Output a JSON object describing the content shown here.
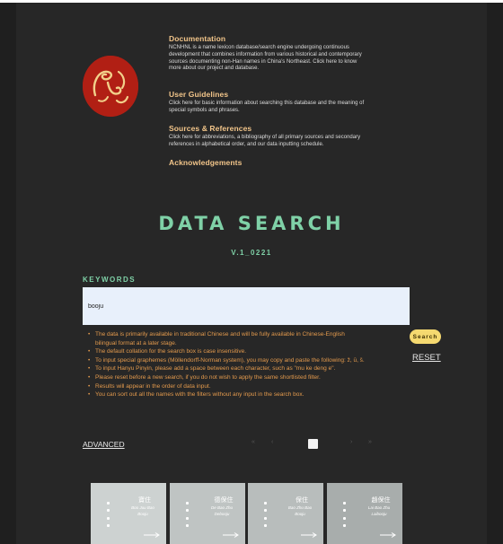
{
  "intro": {
    "sections": [
      {
        "heading": "Documentation",
        "text": "NCNHNL is a name lexicon database/search engine undergoing continuous development that combines information from various historical and contemporary sources documenting non-Han names in China’s Northeast. Click here to know more about our project and database."
      },
      {
        "heading": "User Guidelines",
        "text": "Click here for basic information about searching this database and the meaning of special symbols and phrases."
      },
      {
        "heading": "Sources & References",
        "text": "Click here for abbreviations, a bibliography of all primary sources and secondary references in alphabetical order, and our data inputting schedule."
      },
      {
        "heading": "Acknowledgements",
        "text": ""
      }
    ]
  },
  "search": {
    "title": "DATA SEARCH",
    "version": "V.1_0221",
    "keywords_label": "KEYWORDS",
    "query": "booju",
    "search_label": "Search",
    "reset_label": "RESET",
    "advanced_label": "ADVANCED"
  },
  "notes": [
    "The data is primarily available in traditional Chinese and will be fully available in Chinese-English bilingual format at a later stage.",
    "The default collation for the search box is case insensitive.",
    "To input special graphemes (Möllendorff-Norman system), you may copy and paste the following: ž, ū, š.",
    "To input Hanyu Pinyin, please add a space between each character, such as \"mu ke deng e\".",
    "Please reset before a new search, if you do not wish to apply the same shortlisted filter.",
    "Results will appear in the order of data input.",
    "You can sort out all the names with the filters without any input in the search box."
  ],
  "pagination": {
    "first": "«",
    "prev": "‹",
    "next": "›",
    "last": "»"
  },
  "results": [
    {
      "name": "寶住",
      "romanized": "Boo Juu Bao",
      "transcription": "Booju",
      "color": "#cdd2d1"
    },
    {
      "name": "德保住",
      "romanized": "De Bao Zhu",
      "transcription": "Debooju",
      "color": "#bfc4c3"
    },
    {
      "name": "保住",
      "romanized": "Bao Zhu Bao",
      "transcription": "Booju",
      "color": "#b8bdbc"
    },
    {
      "name": "趙保住",
      "romanized": "Lai Bao Zhu",
      "transcription": "Laibooju",
      "color": "#a8adac"
    }
  ],
  "colors": {
    "background": "#272727",
    "accent_green": "#7fd1a7",
    "heading_peach": "#f2c58a",
    "note_orange": "#e39a4d",
    "search_button": "#f5d970",
    "logo_red": "#b11f14"
  }
}
